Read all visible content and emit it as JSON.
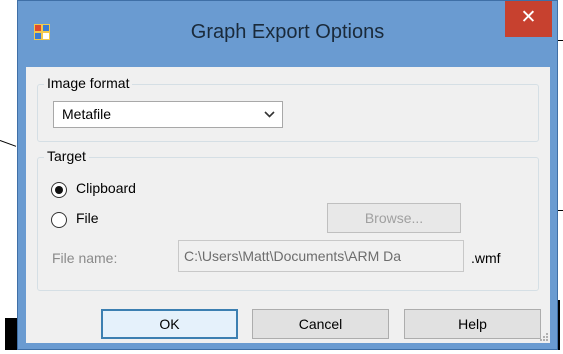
{
  "window": {
    "title": "Graph Export Options",
    "close_glyph": "✕",
    "icon": "app-icon"
  },
  "image_format": {
    "group_label": "Image format",
    "selected": "Metafile",
    "arrow_glyph": "⌄"
  },
  "target": {
    "group_label": "Target",
    "clipboard_label": "Clipboard",
    "clipboard_checked": true,
    "file_label": "File",
    "file_checked": false,
    "browse_label": "Browse...",
    "file_name_label": "File name:",
    "file_name_value": "C:\\Users\\Matt\\Documents\\ARM Da",
    "extension": ".wmf"
  },
  "buttons": {
    "ok": "OK",
    "cancel": "Cancel",
    "help": "Help"
  },
  "colors": {
    "title_bar": "#6a9bd1",
    "close_button": "#c7412f",
    "dialog_bg": "#f0f0f0"
  }
}
